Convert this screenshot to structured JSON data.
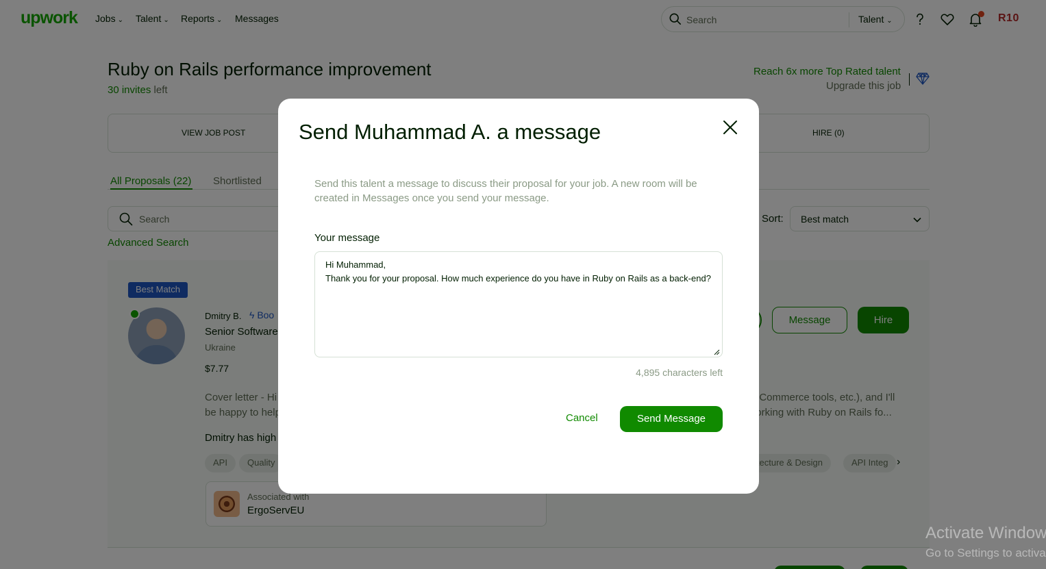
{
  "header": {
    "logo": "upwork",
    "nav": [
      {
        "label": "Jobs",
        "has_dropdown": true
      },
      {
        "label": "Talent",
        "has_dropdown": true
      },
      {
        "label": "Reports",
        "has_dropdown": true
      },
      {
        "label": "Messages",
        "has_dropdown": false
      }
    ],
    "search_placeholder": "Search",
    "search_scope": "Talent",
    "icons": [
      "help-icon",
      "heart-icon",
      "bell-icon"
    ],
    "avatar_initials": "R10"
  },
  "job": {
    "title": "Ruby on Rails performance improvement",
    "invites_count": "30 invites",
    "invites_suffix": " left",
    "upsell_line1": "Reach 6x more Top Rated talent",
    "upsell_line2": "Upgrade this job"
  },
  "job_tabs": {
    "view_job_post": "VIEW JOB POST",
    "hire": "HIRE (0)"
  },
  "proposal_tabs": [
    {
      "label": "All Proposals (22)",
      "active": true
    },
    {
      "label": "Shortlisted",
      "active": false
    }
  ],
  "filters": {
    "search_placeholder": "Search",
    "advanced_search": "Advanced Search",
    "sort_label": "Sort:",
    "sort_value": "Best match"
  },
  "freelancer": {
    "badge": "Best Match",
    "name": "Dmitry B.",
    "boost_text": "Boo",
    "title": "Senior Software",
    "country": "Ukraine",
    "rate": "$7.77",
    "cover_line1": "Cover letter - Hi",
    "cover_line2": "be happy to help",
    "cover_right1": "eCommerce tools, etc.), and I'll",
    "cover_right2": "n working with Ruby on Rails fo...",
    "highlight": "Dmitry has high",
    "skills_left": [
      "API",
      "Quality"
    ],
    "skills_right": [
      "itecture & Design",
      "API Integ"
    ],
    "associated_label": "Associated with",
    "associated_name": "ErgoServEU",
    "message_button": "Message",
    "hire_button": "Hire"
  },
  "modal": {
    "title": "Send Muhammad A. a message",
    "description": "Send this talent a message to discuss their proposal for your job. A new room will be created in Messages once you send your message.",
    "message_label": "Your message",
    "message_value": "Hi Muhammad,\nThank you for your proposal. How much experience do you have in Ruby on Rails as a back-end?",
    "chars_left": "4,895 characters left",
    "cancel_label": "Cancel",
    "send_label": "Send Message"
  },
  "watermark": {
    "line1": "Activate Windows",
    "line2": "Go to Settings to activate Windows."
  },
  "colors": {
    "brand_green": "#108a00",
    "logo_green": "#14a800",
    "best_match_blue": "#1f57c3",
    "overlay": "rgba(0,0,0,0.5)"
  }
}
